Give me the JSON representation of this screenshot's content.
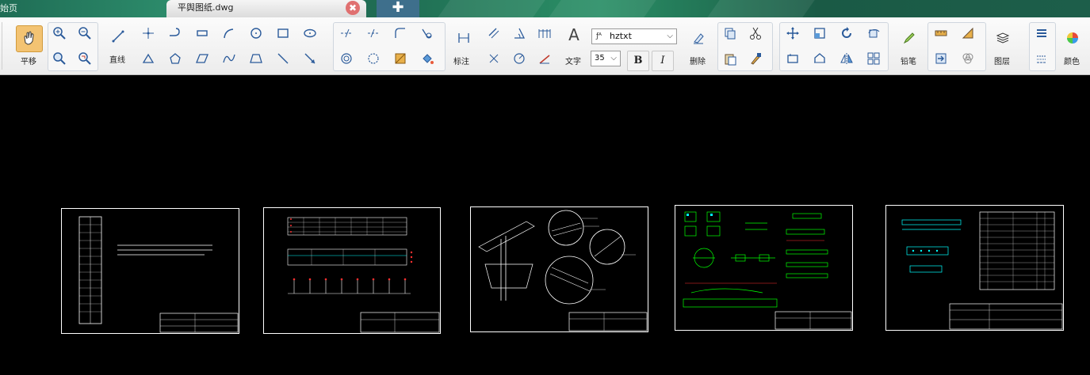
{
  "titlebar": {
    "home_tab": "始页",
    "doc_tab": "平舆图纸.dwg",
    "close_glyph": "✖",
    "add_glyph": "✚"
  },
  "ribbon": {
    "pan_label": "平移",
    "line_label": "直线",
    "dimension_label": "标注",
    "text_label": "文字",
    "text_icon": "A",
    "font_value": "hztxt",
    "font_prefix": "ƒᴬ",
    "size_value": "35",
    "bold_label": "B",
    "italic_label": "I",
    "delete_label": "删除",
    "pencil_label": "铅笔",
    "layer_label": "图层",
    "color_label": "颜色"
  },
  "colors": {
    "icon_blue": "#1f5fa8",
    "active_orange": "#f3c372",
    "cad_white": "#ffffff",
    "cad_green": "#00ff00",
    "cad_red": "#ff3030",
    "cad_cyan": "#00ffff"
  }
}
